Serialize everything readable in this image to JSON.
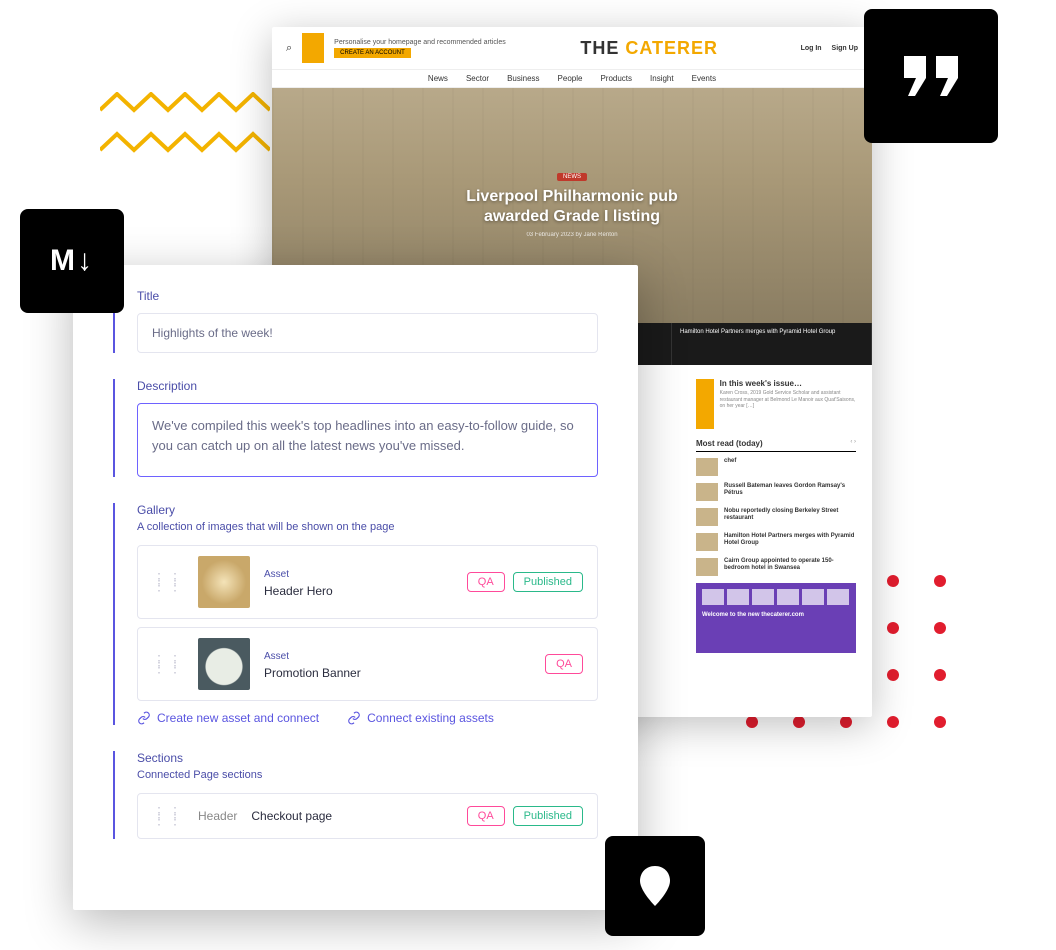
{
  "site": {
    "logo_part1": "THE ",
    "logo_part2": "CATERER",
    "cta_line": "Personalise your homepage and recommended articles",
    "cta_button": "CREATE AN ACCOUNT",
    "auth": {
      "login": "Log In",
      "signup": "Sign Up"
    },
    "nav": [
      "News",
      "Sector",
      "Business",
      "People",
      "Products",
      "Insight",
      "Events"
    ],
    "hero_tag": "NEWS",
    "hero_headline": "Liverpool Philharmonic pub awarded Grade I listing",
    "hero_byline": "03 February 2023 by Jane Renton",
    "strip": [
      "",
      "",
      "Hamilton Hotel Partners merges with Pyramid Hotel Group"
    ],
    "issue_title": "In this week's issue…",
    "issue_blurb": "Karen Cross, 2019 Gold Service Scholar and assistant restaurant manager at Belmond Le Manoir aux Quat'Saisons, on her year […]",
    "most_read_label": "Most read (today)",
    "most_read": [
      "chef",
      "Russell Bateman leaves Gordon Ramsay's Pétrus",
      "Nobu reportedly closing Berkeley Street restaurant",
      "Hamilton Hotel Partners merges with Pyramid Hotel Group",
      "Cairn Group appointed to operate 150-bedroom hotel in Swansea"
    ],
    "purple_caption": "Welcome to the new thecaterer.com"
  },
  "cms": {
    "title_label": "Title",
    "title_value": "Highlights of the week!",
    "desc_label": "Description",
    "desc_value": "We've compiled this week's top headlines into an easy-to-follow guide, so you can catch up on all the latest news you've missed.",
    "gallery_label": "Gallery",
    "gallery_sub": "A collection of images that will be shown on the page",
    "asset_kind": "Asset",
    "assets": [
      {
        "name": "Header Hero",
        "qa": true,
        "published": true
      },
      {
        "name": "Promotion Banner",
        "qa": true,
        "published": false
      }
    ],
    "link_create": "Create new asset and connect",
    "link_connect": "Connect existing assets",
    "sections_label": "Sections",
    "sections_sub": "Connected Page sections",
    "section_type": "Header",
    "section_name": "Checkout page",
    "badge_qa": "QA",
    "badge_pub": "Published"
  },
  "tiles": {
    "md": "M↓"
  }
}
